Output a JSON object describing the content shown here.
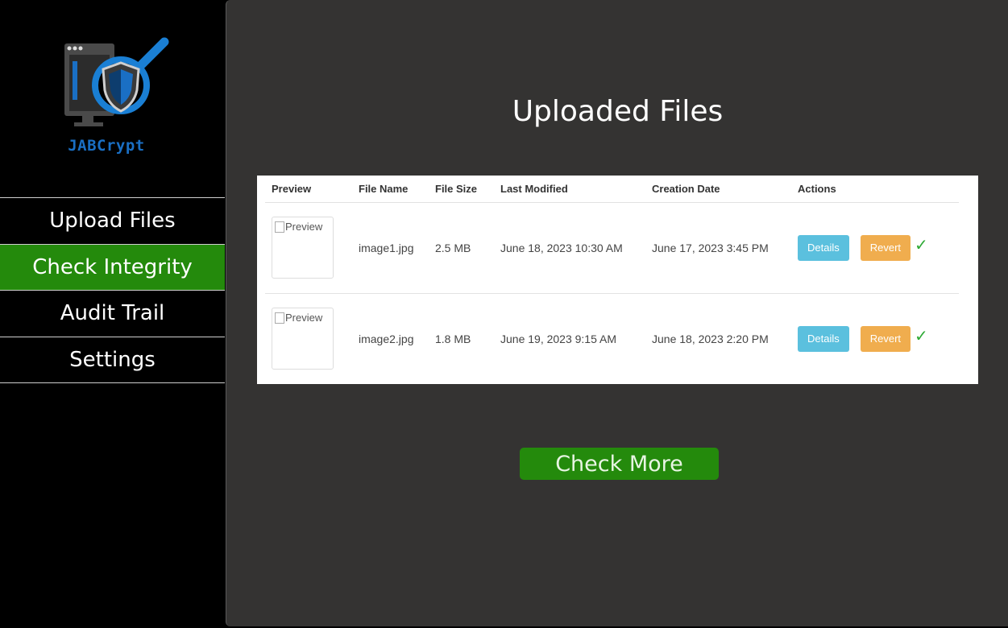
{
  "app": {
    "name": "JABCrypt"
  },
  "sidebar": {
    "items": [
      {
        "label": "Upload Files",
        "active": false
      },
      {
        "label": "Check Integrity",
        "active": true
      },
      {
        "label": "Audit Trail",
        "active": false
      },
      {
        "label": "Settings",
        "active": false
      }
    ]
  },
  "main": {
    "title": "Uploaded Files",
    "table": {
      "headers": [
        "Preview",
        "File Name",
        "File Size",
        "Last Modified",
        "Creation Date",
        "Actions"
      ],
      "rows": [
        {
          "preview_alt": "Preview",
          "file_name": "image1.jpg",
          "file_size": "2.5 MB",
          "last_modified": "June 18, 2023 10:30 AM",
          "creation_date": "June 17, 2023 3:45 PM",
          "details_label": "Details",
          "revert_label": "Revert",
          "verified": "✓"
        },
        {
          "preview_alt": "Preview",
          "file_name": "image2.jpg",
          "file_size": "1.8 MB",
          "last_modified": "June 19, 2023 9:15 AM",
          "creation_date": "June 18, 2023 2:20 PM",
          "details_label": "Details",
          "revert_label": "Revert",
          "verified": "✓"
        }
      ]
    },
    "check_more_label": "Check More"
  },
  "colors": {
    "accent_green": "#248a0c",
    "details_blue": "#5bc0de",
    "revert_orange": "#f0ad4e",
    "logo_blue": "#1a6fc4"
  },
  "icons": {
    "logo": "monitor-shield-magnifier-icon",
    "verified": "check-icon",
    "broken_image": "broken-image-icon"
  }
}
